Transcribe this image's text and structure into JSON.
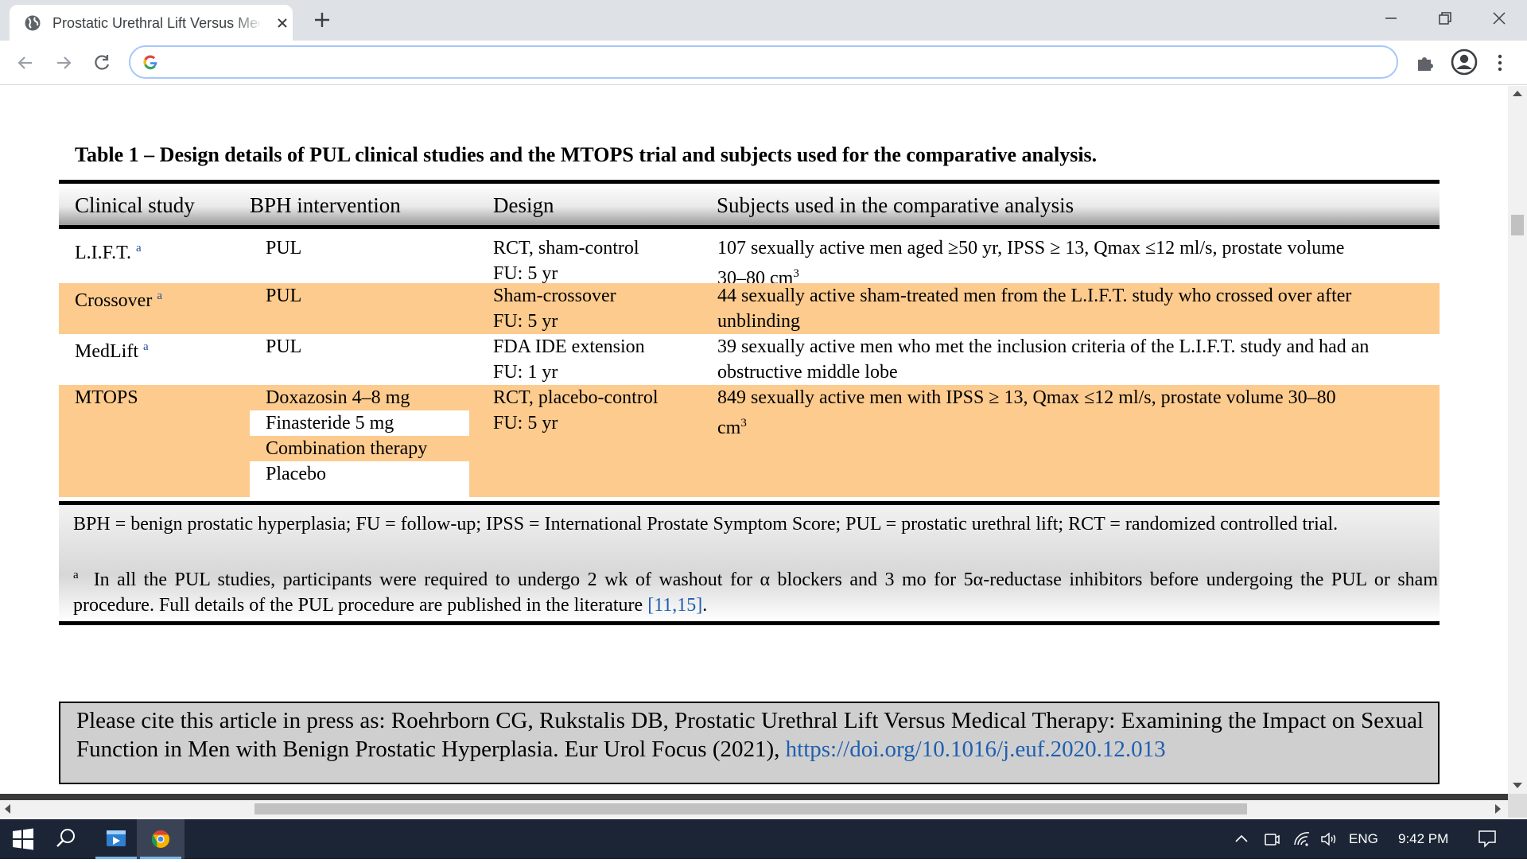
{
  "browser": {
    "tab_title": "Prostatic Urethral Lift Versus Medical Therapy",
    "address_value": ""
  },
  "document": {
    "table_title": "Table 1 – Design details of PUL clinical studies and the MTOPS trial and subjects used for the comparative analysis.",
    "headers": [
      "Clinical study",
      "BPH intervention",
      "Design",
      "Subjects used in the comparative analysis"
    ],
    "rows": [
      {
        "study": "L.I.F.T.",
        "study_sup": "a",
        "interventions": [
          "PUL"
        ],
        "design": [
          "RCT, sham-control",
          "FU: 5 yr"
        ],
        "subjects_line1": "107 sexually active men aged ≥50 yr, IPSS ≥ 13, Qmax ≤12 ml/s, prostate volume",
        "subjects_line2": "30–80 cm",
        "subjects_sup": "3"
      },
      {
        "study": "Crossover",
        "study_sup": "a",
        "interventions": [
          "PUL"
        ],
        "design": [
          "Sham-crossover",
          "FU: 5 yr"
        ],
        "subjects_line1": "44 sexually active sham-treated men from the L.I.F.T. study who crossed over after",
        "subjects_line2": "unblinding"
      },
      {
        "study": "MedLift",
        "study_sup": "a",
        "interventions": [
          "PUL"
        ],
        "design": [
          "FDA IDE extension",
          "FU: 1 yr"
        ],
        "subjects_line1": "39 sexually active men who met the inclusion criteria of the L.I.F.T. study and had an",
        "subjects_line2": "obstructive middle lobe"
      },
      {
        "study": "MTOPS",
        "interventions": [
          "Doxazosin 4–8 mg",
          "Finasteride 5 mg",
          "Combination therapy",
          "Placebo"
        ],
        "design": [
          "RCT, placebo-control",
          "FU: 5 yr"
        ],
        "subjects_line1": "849 sexually active men with IPSS ≥ 13, Qmax ≤12 ml/s, prostate volume 30–80",
        "subjects_line2": "cm",
        "subjects_sup": "3"
      }
    ],
    "footnote_abbrev": "BPH = benign prostatic hyperplasia; FU = follow-up; IPSS = International Prostate Symptom Score; PUL = prostatic urethral lift; RCT = randomized controlled trial.",
    "footnote_a_sup": "a",
    "footnote_a_text": "In all the PUL studies, participants were required to undergo 2 wk of washout for α blockers and 3 mo for 5α-reductase inhibitors before undergoing the PUL or sham procedure. Full details of the PUL procedure are published in the literature",
    "footnote_a_ref": "[11,15]",
    "footnote_a_end": ".",
    "citation_text": "Please cite this article in press as: Roehrborn  CG, Rukstalis  DB, Prostatic Urethral Lift Versus Medical Therapy: Examining the Impact on Sexual Function in Men with Benign Prostatic Hyperplasia. Eur Urol Focus (2021),",
    "citation_doi": "https://doi.org/10.1016/j.euf.2020.12.013"
  },
  "taskbar": {
    "language": "ENG",
    "time": "9:42 PM"
  },
  "colors": {
    "row_highlight": "#fdcb8e",
    "link": "#1f5fb0",
    "taskbar": "#1c2536"
  }
}
